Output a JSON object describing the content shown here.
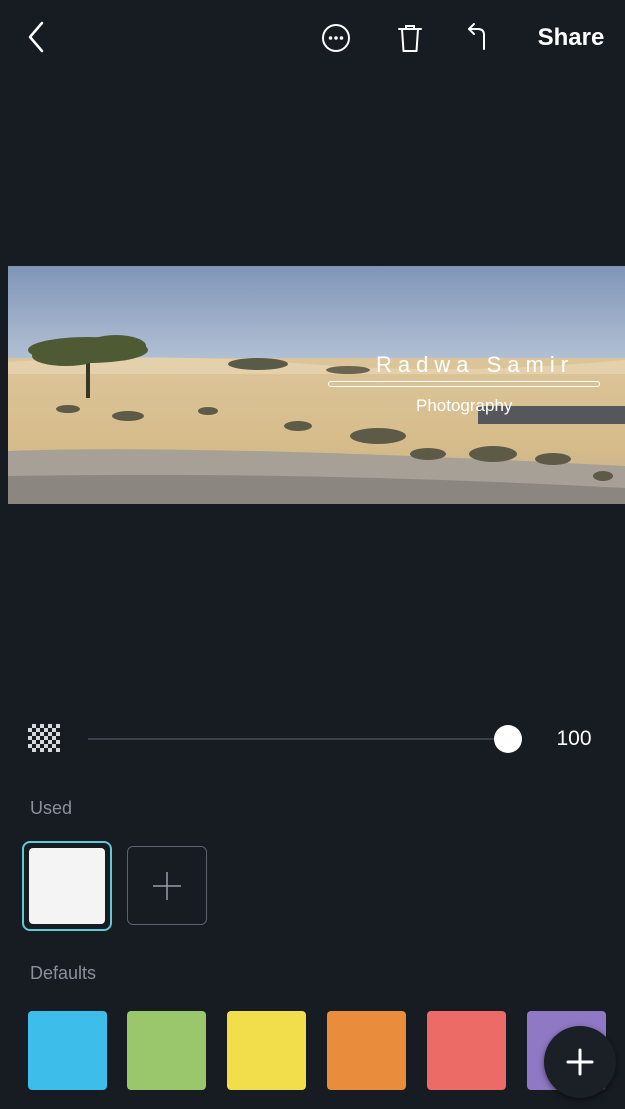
{
  "toolbar": {
    "back_icon": "chevron-left-icon",
    "more_icon": "more-circle-icon",
    "delete_icon": "trash-icon",
    "undo_icon": "undo-icon",
    "share_label": "Share"
  },
  "photo": {
    "watermark_name": "Radwa Samir",
    "watermark_subtitle": "Photography"
  },
  "opacity": {
    "icon": "checker-opacity-icon",
    "value": "100",
    "level": 1.0
  },
  "sections": {
    "used_label": "Used",
    "defaults_label": "Defaults"
  },
  "used_colors": [
    "#f4f4f4"
  ],
  "default_colors": [
    "#3dbdea",
    "#9ac66c",
    "#f1de4a",
    "#e98c3b",
    "#ec6b66",
    "#8f78c4"
  ],
  "fab": {
    "icon": "plus-icon"
  }
}
